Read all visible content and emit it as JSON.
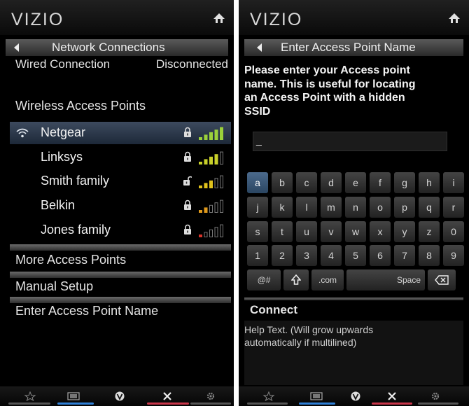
{
  "left": {
    "logo": "VIZIO",
    "title": "Network Connections",
    "wired_label": "Wired Connection",
    "wired_status": "Disconnected",
    "wireless_header": "Wireless Access Points",
    "access_points": [
      {
        "name": "Netgear",
        "locked": true,
        "signal": 5,
        "color": "#9bd13a"
      },
      {
        "name": "Linksys",
        "locked": true,
        "signal": 4,
        "color": "#c8d02a"
      },
      {
        "name": "Smith family",
        "locked": false,
        "signal": 3,
        "color": "#e0c21c"
      },
      {
        "name": "Belkin",
        "locked": true,
        "signal": 2,
        "color": "#e09a1c"
      },
      {
        "name": "Jones family",
        "locked": true,
        "signal": 1,
        "color": "#d8342a"
      }
    ],
    "more_label": "More Access Points",
    "manual_label": "Manual Setup",
    "enter_label": "Enter Access Point Name"
  },
  "right": {
    "logo": "VIZIO",
    "title": "Enter Access Point Name",
    "prompt_lines": [
      "Please enter your Access point",
      "name. This is useful for locating",
      "an Access Point with a hidden",
      "SSID"
    ],
    "input_value": "_",
    "keyboard_rows": [
      [
        "a",
        "b",
        "c",
        "d",
        "e",
        "f",
        "g",
        "h",
        "i"
      ],
      [
        "j",
        "k",
        "l",
        "m",
        "n",
        "o",
        "p",
        "q",
        "r"
      ],
      [
        "s",
        "t",
        "u",
        "v",
        "w",
        "x",
        "y",
        "z",
        "0"
      ],
      [
        "1",
        "2",
        "3",
        "4",
        "5",
        "6",
        "7",
        "8",
        "9"
      ]
    ],
    "special_keys": {
      "symbols": "@#",
      "dotcom": ".com",
      "space": "Space"
    },
    "connect_label": "Connect",
    "help_lines": [
      "Help Text. (Will grow upwards",
      "automatically if multilined)"
    ]
  },
  "colors": {
    "accent_blue": "#2e7fd6",
    "accent_red": "#c8364a",
    "selected_key": "#3f5f82"
  }
}
